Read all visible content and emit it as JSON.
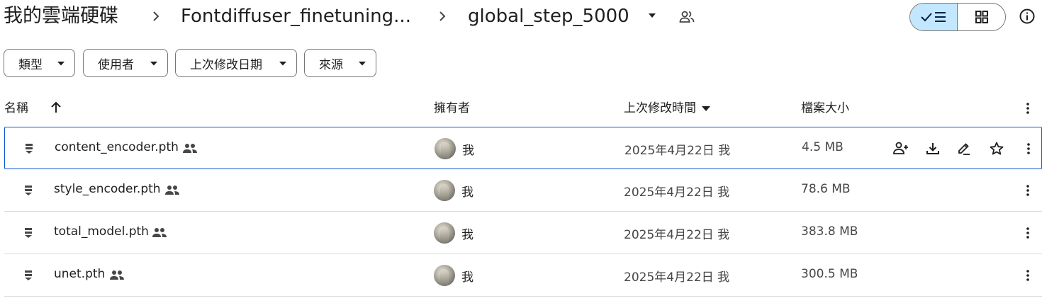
{
  "breadcrumb": {
    "root": "我的雲端硬碟",
    "folder": "Fontdiffuser_finetuning...",
    "current": "global_step_5000"
  },
  "icons": {
    "separator": "chevron-right-icon",
    "dropdown": "caret-down-icon",
    "shared": "people-icon",
    "list_view": "check-list-icon",
    "grid_view": "grid-icon",
    "info": "info-icon",
    "sort_up": "arrow-up-icon",
    "file": "file-icon",
    "more": "more-vert-icon",
    "share": "add-person-icon",
    "download": "download-icon",
    "rename": "pencil-icon",
    "star": "star-icon"
  },
  "colors": {
    "selected_view_bg": "#c2e7ff",
    "selected_row_border": "#0b57d0",
    "divider": "#dadce0"
  },
  "filters": [
    {
      "label": "類型"
    },
    {
      "label": "使用者"
    },
    {
      "label": "上次修改日期"
    },
    {
      "label": "來源"
    }
  ],
  "columns": {
    "name": "名稱",
    "owner": "擁有者",
    "modified": "上次修改時間",
    "size": "檔案大小"
  },
  "rows": [
    {
      "name": "content_encoder.pth",
      "owner": "我",
      "modified": "2025年4月22日 我",
      "size": "4.5 MB",
      "selected": true
    },
    {
      "name": "style_encoder.pth",
      "owner": "我",
      "modified": "2025年4月22日 我",
      "size": "78.6 MB",
      "selected": false
    },
    {
      "name": "total_model.pth",
      "owner": "我",
      "modified": "2025年4月22日 我",
      "size": "383.8 MB",
      "selected": false
    },
    {
      "name": "unet.pth",
      "owner": "我",
      "modified": "2025年4月22日 我",
      "size": "300.5 MB",
      "selected": false
    }
  ]
}
